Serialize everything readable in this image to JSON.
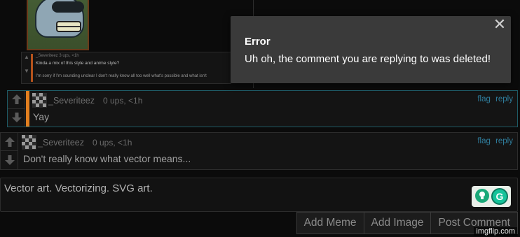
{
  "top": {
    "mini_comment": {
      "meta": "_Severiteez  3 ups, <1h",
      "line1": "Kinda a mix of this style and anime style?",
      "line2": "I'm sorry if I'm sounding unclear I don't really know all too well what's possible and what isn't"
    }
  },
  "comments": [
    {
      "username": "_Severiteez",
      "meta": "0 ups, <1h",
      "text": "Yay",
      "flag": "flag",
      "reply": "reply"
    },
    {
      "username": "_Severiteez",
      "meta": "0 ups, <1h",
      "text": "Don't really know what vector means...",
      "flag": "flag",
      "reply": "reply"
    }
  ],
  "reply_box": {
    "value": "Vector art. Vectorizing. SVG art."
  },
  "buttons": {
    "add_meme": "Add Meme",
    "add_image": "Add Image",
    "post_comment": "Post Comment"
  },
  "popup": {
    "title": "Error",
    "message": "Uh oh, the comment you are replying to was deleted!",
    "close": "✕"
  },
  "watermark": "imgflip.com",
  "colors": {
    "accent_orange": "#e27f1f",
    "link_blue": "#2f7e9e",
    "popup_bg": "#3a3a3a",
    "grammarly_green": "#15c39a"
  }
}
